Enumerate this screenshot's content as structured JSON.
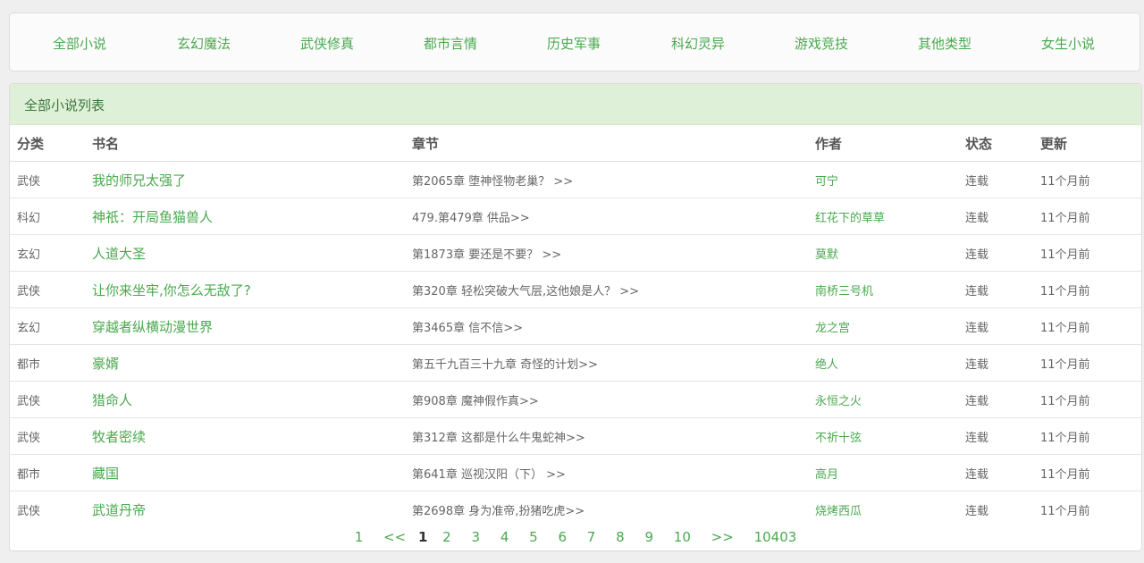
{
  "nav": [
    "全部小说",
    "玄幻魔法",
    "武侠修真",
    "都市言情",
    "历史军事",
    "科幻灵异",
    "游戏竞技",
    "其他类型",
    "女生小说"
  ],
  "panel_title": "全部小说列表",
  "headers": [
    "分类",
    "书名",
    "章节",
    "作者",
    "状态",
    "更新"
  ],
  "rows": [
    {
      "cat": "武侠",
      "name": "我的师兄太强了",
      "chapter": "第2065章 堕神怪物老巢？ >>",
      "author": "可宁",
      "status": "连载",
      "updated": "11个月前"
    },
    {
      "cat": "科幻",
      "name": "神祇：开局鱼猫兽人",
      "chapter": "479.第479章 供品>>",
      "author": "红花下的草草",
      "status": "连载",
      "updated": "11个月前"
    },
    {
      "cat": "玄幻",
      "name": "人道大圣",
      "chapter": "第1873章 要还是不要？ >>",
      "author": "莫默",
      "status": "连载",
      "updated": "11个月前"
    },
    {
      "cat": "武侠",
      "name": "让你来坐牢,你怎么无敌了?",
      "chapter": "第320章 轻松突破大气层,这他娘是人？ >>",
      "author": "南桥三号机",
      "status": "连载",
      "updated": "11个月前"
    },
    {
      "cat": "玄幻",
      "name": "穿越者纵横动漫世界",
      "chapter": "第3465章 信不信>>",
      "author": "龙之宫",
      "status": "连载",
      "updated": "11个月前"
    },
    {
      "cat": "都市",
      "name": "豪婿",
      "chapter": "第五千九百三十九章 奇怪的计划>>",
      "author": "绝人",
      "status": "连载",
      "updated": "11个月前"
    },
    {
      "cat": "武侠",
      "name": "猎命人",
      "chapter": "第908章 魔神假作真>>",
      "author": "永恒之火",
      "status": "连载",
      "updated": "11个月前"
    },
    {
      "cat": "武侠",
      "name": "牧者密续",
      "chapter": "第312章 这都是什么牛鬼蛇神>>",
      "author": "不祈十弦",
      "status": "连载",
      "updated": "11个月前"
    },
    {
      "cat": "都市",
      "name": "藏国",
      "chapter": "第641章 巡视汉阳（下） >>",
      "author": "高月",
      "status": "连载",
      "updated": "11个月前"
    },
    {
      "cat": "武侠",
      "name": "武道丹帝",
      "chapter": "第2698章 身为准帝,扮猪吃虎>>",
      "author": "烧烤西瓜",
      "status": "连载",
      "updated": "11个月前"
    }
  ],
  "pager": {
    "first": "1",
    "prev": "<<",
    "current": "1",
    "pages": [
      "2",
      "3",
      "4",
      "5",
      "6",
      "7",
      "8",
      "9",
      "10"
    ],
    "next": ">>",
    "last": "10403"
  },
  "colors": {
    "accent": "#4aa94f",
    "panel_head_bg": "#dff0d8",
    "panel_title": "#3c763d"
  }
}
